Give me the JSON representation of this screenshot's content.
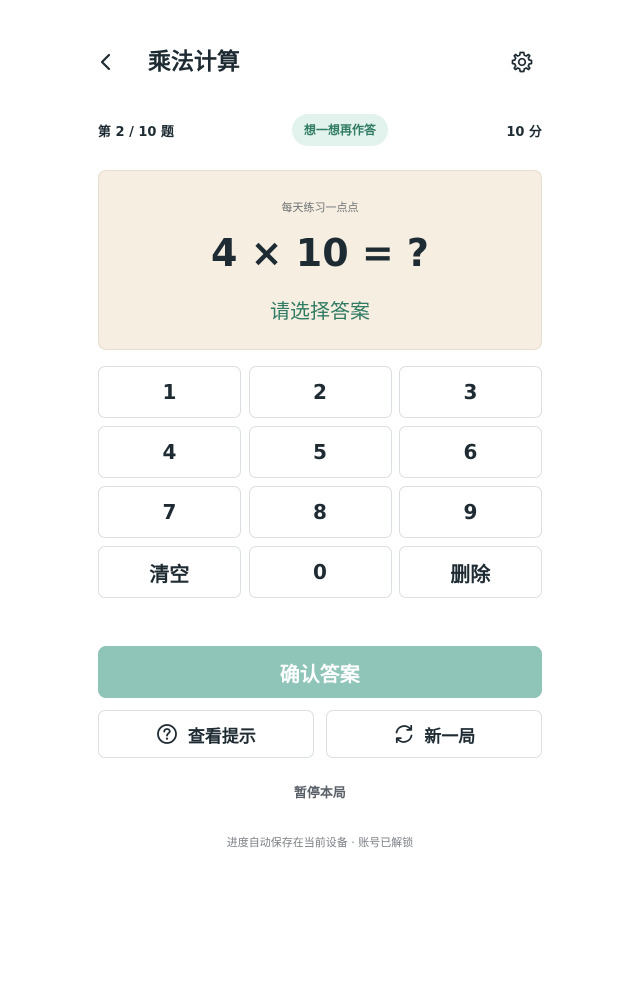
{
  "header": {
    "title": "乘法计算",
    "back_icon": "chevron-left-icon",
    "settings_icon": "gear-icon"
  },
  "status": {
    "progress": "第 2 / 10 题",
    "hint_badge": "想一想再作答",
    "score": "10 分"
  },
  "question_card": {
    "subtitle": "每天练习一点点",
    "question": "4 × 10 = ?",
    "answer_prompt": "请选择答案"
  },
  "keypad": {
    "keys": [
      "1",
      "2",
      "3",
      "4",
      "5",
      "6",
      "7",
      "8",
      "9",
      "清空",
      "0",
      "删除"
    ]
  },
  "actions": {
    "confirm": "确认答案",
    "hint": "查看提示",
    "hint_icon": "question-circle-icon",
    "new_game": "新一局",
    "new_game_icon": "refresh-icon",
    "pause": "暂停本局"
  },
  "footer": {
    "note": "进度自动保存在当前设备 · 账号已解锁"
  },
  "colors": {
    "accent": "#2f7b64",
    "badge_bg": "#e2f2ec",
    "card_bg": "#f6eee0",
    "confirm_bg": "#8fc4b8",
    "text": "#1e2b33"
  }
}
